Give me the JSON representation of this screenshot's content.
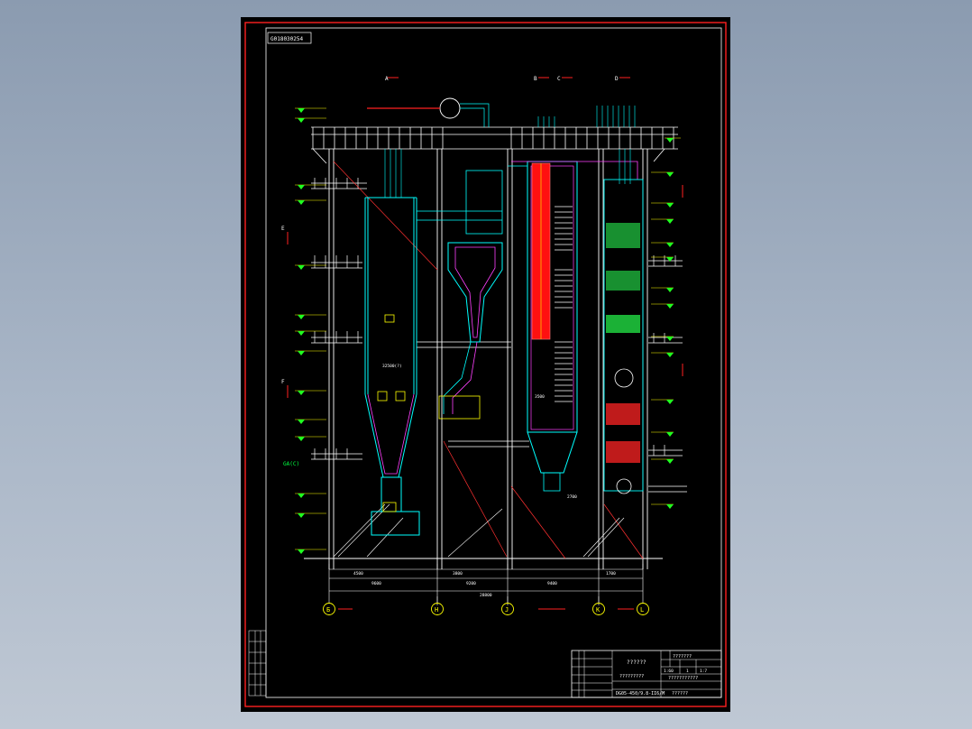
{
  "drawing": {
    "sheet_code": "G018030254",
    "column_axes": [
      {
        "id": "axis-G",
        "label": "Б"
      },
      {
        "id": "axis-H",
        "label": "H"
      },
      {
        "id": "axis-J",
        "label": "J"
      },
      {
        "id": "axis-K",
        "label": "K"
      },
      {
        "id": "axis-L",
        "label": "L"
      }
    ],
    "section_marks": [
      "A",
      "B",
      "C",
      "D",
      "E",
      "F"
    ],
    "dimensions": {
      "bottom_row_1": [
        "4500",
        "3800",
        "1700"
      ],
      "bottom_row_2": [
        "9600",
        "9200",
        "9400"
      ],
      "overall": "28800"
    },
    "inline_labels": {
      "left_side": "GA(C)",
      "furnace": "32500(?)",
      "ash_hopper": "3500",
      "economizer": "2700"
    }
  },
  "title_block": {
    "project_title": "??????",
    "drawing_name": "?????????",
    "drawing_number": "DG05-450/9.8-II6/M",
    "label_right_top": "???????",
    "scale_row": [
      "1:60",
      "1",
      "1:7"
    ],
    "company": "???????????",
    "sheet_row": "??????"
  }
}
